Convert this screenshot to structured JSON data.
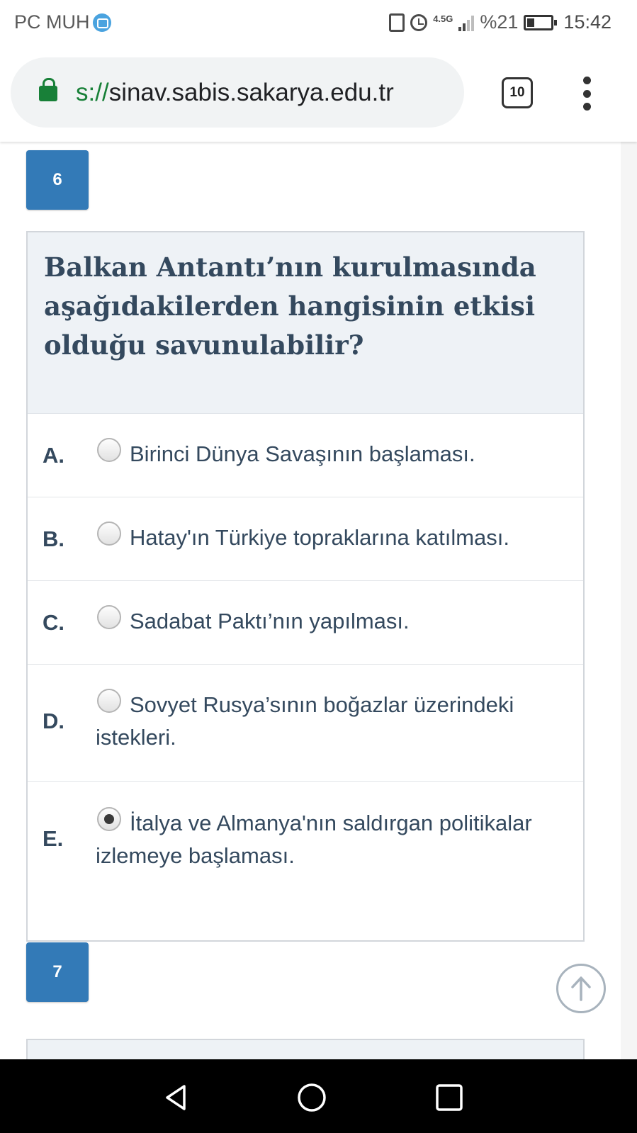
{
  "status_bar": {
    "carrier": "PC MUH",
    "network": "4.5G",
    "battery": "%21",
    "time": "15:42"
  },
  "browser": {
    "url_scheme": "s://",
    "url_host": "sinav.sabis.sakarya.edu.tr",
    "tab_count": "10"
  },
  "question": {
    "number": "6",
    "text": "Balkan Antantı’nın kurulmasında aşağıdakilerden hangisinin etkisi olduğu savunulabilir?",
    "options": [
      {
        "letter": "A.",
        "text": "Birinci Dünya Savaşının başlaması.",
        "selected": false
      },
      {
        "letter": "B.",
        "text": "Hatay'ın Türkiye topraklarına katılması.",
        "selected": false
      },
      {
        "letter": "C.",
        "text": "Sadabat Paktı’nın yapılması.",
        "selected": false
      },
      {
        "letter": "D.",
        "text": "Sovyet Rusya’sının boğazlar üzerindeki istekleri.",
        "selected": false
      },
      {
        "letter": "E.",
        "text": "İtalya ve Almanya'nın saldırgan politikalar izlemeye başlaması.",
        "selected": true
      }
    ]
  },
  "next_question": {
    "number": "7"
  },
  "colors": {
    "accent": "#337ab7",
    "text": "#34495e",
    "secure": "#188038"
  }
}
